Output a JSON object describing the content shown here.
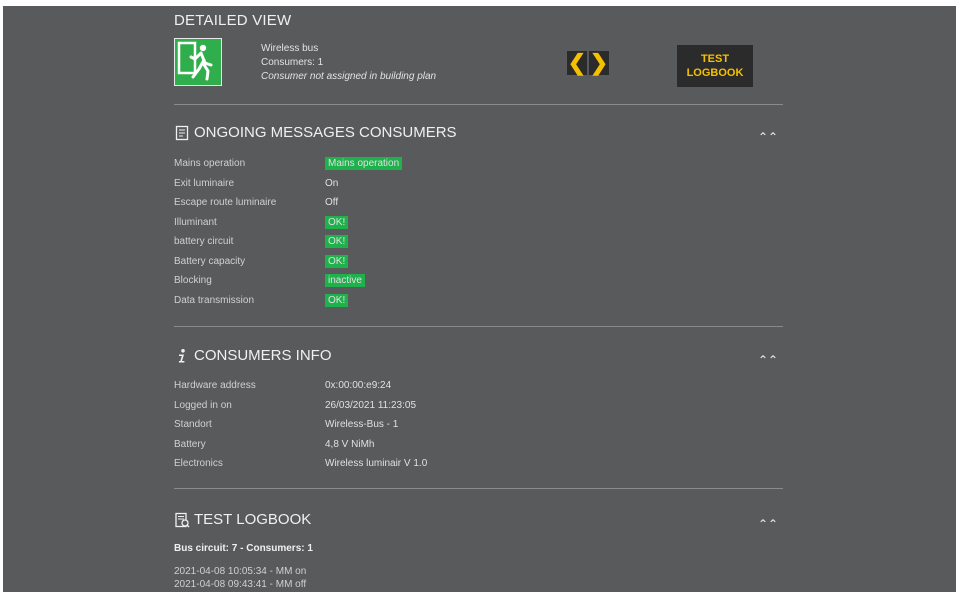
{
  "header": {
    "title": "DETAILED VIEW",
    "bus": "Wireless bus",
    "consumers": "Consumers: 1",
    "note": "Consumer not assigned in building plan",
    "nav_prev": "❮",
    "nav_next": "❯",
    "logbook_line1": "TEST",
    "logbook_line2": "LOGBOOK"
  },
  "messages": {
    "title": "ONGOING MESSAGES CONSUMERS",
    "rows": [
      {
        "label": "Mains operation",
        "value": "Mains operation"
      },
      {
        "label": "Exit luminaire",
        "value": "On"
      },
      {
        "label": "Escape route luminaire",
        "value": "Off"
      },
      {
        "label": "Illuminant",
        "value": "OK!"
      },
      {
        "label": "battery circuit",
        "value": "OK!"
      },
      {
        "label": "Battery capacity",
        "value": "OK!"
      },
      {
        "label": "Blocking",
        "value": "inactive"
      },
      {
        "label": "Data transmission",
        "value": "OK!"
      }
    ]
  },
  "info": {
    "title": "CONSUMERS INFO",
    "rows": [
      {
        "label": "Hardware address",
        "value": "0x:00:00:e9:24"
      },
      {
        "label": "Logged in on",
        "value": "26/03/2021 11:23:05"
      },
      {
        "label": "Standort",
        "value": "Wireless-Bus - 1"
      },
      {
        "label": "Battery",
        "value": "4,8 V NiMh"
      },
      {
        "label": "Electronics",
        "value": "Wireless luminair V 1.0"
      }
    ]
  },
  "logbook": {
    "title": "TEST LOGBOOK",
    "subtitle": "Bus circuit: 7 - Consumers: 1",
    "entries": [
      "2021-04-08 10:05:34 - MM on",
      "2021-04-08 09:43:41 - MM off"
    ]
  },
  "colors": {
    "panel": "#595a5b",
    "accent": "#f5c000",
    "status_green": "#1fb14c"
  },
  "icons": {
    "exit": "exit-sign-icon",
    "messages": "document-icon",
    "info": "info-icon",
    "logbook": "logbook-icon",
    "collapse": "double-chevron-up-icon"
  }
}
